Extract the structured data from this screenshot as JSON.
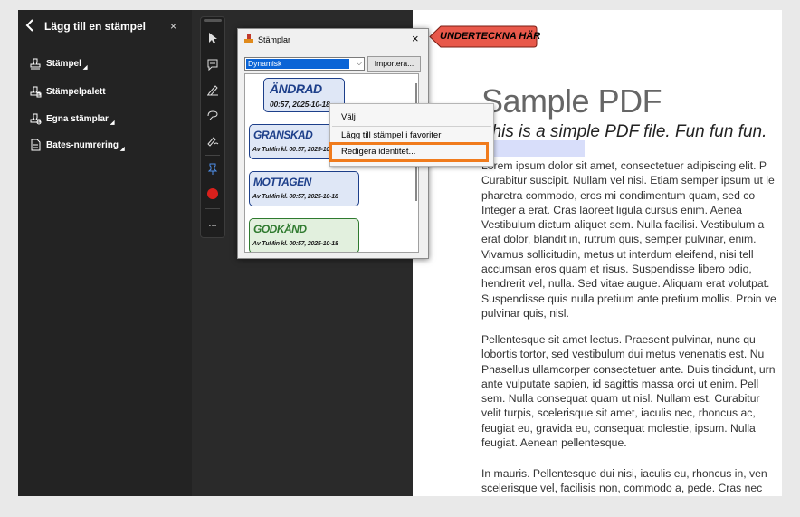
{
  "panel": {
    "title": "Lägg till en stämpel",
    "close_glyph": "×",
    "items": [
      {
        "label": "Stämpel",
        "icon": "stamp-icon"
      },
      {
        "label": "Stämpelpalett",
        "icon": "stamp-palette-icon"
      },
      {
        "label": "Egna stämplar",
        "icon": "custom-stamps-icon"
      },
      {
        "label": "Bates-numrering",
        "icon": "document-icon"
      }
    ]
  },
  "toolbar": {
    "tools": [
      "select-arrow-icon",
      "comment-icon",
      "pen-icon",
      "eraser-icon",
      "signature-icon",
      "pin-icon",
      "color-swatch-icon",
      "more-icon"
    ],
    "more_glyph": "...",
    "active_color": "#d9201c"
  },
  "dialog": {
    "title": "Stämplar",
    "close_glyph": "×",
    "category": "Dynamisk",
    "import_label": "Importera...",
    "stamps": [
      {
        "name": "ÄNDRAD",
        "detail": "00:57, 2025-10-18"
      },
      {
        "name": "GRANSKAD",
        "detail": "Av TuMin kl. 00:57, 2025-10-18"
      },
      {
        "name": "MOTTAGEN",
        "detail": "Av TuMin kl. 00:57, 2025-10-18"
      },
      {
        "name": "GODKÄND",
        "detail": "Av TuMin kl. 00:57, 2025-10-18"
      }
    ]
  },
  "context_menu": {
    "items": [
      "Välj",
      "Lägg till stämpel i favoriter",
      "Redigera identitet..."
    ]
  },
  "callout": {
    "text": "UNDERTECKNA HÄR"
  },
  "document": {
    "title": "Sample PDF",
    "subtitle": "This is a simple PDF file. Fun fun fun.",
    "paragraphs": [
      "Lorem ipsum dolor sit amet, consectetuer adipiscing elit. P\nCurabitur suscipit. Nullam vel nisi. Etiam semper ipsum ut le\npharetra commodo, eros mi condimentum quam, sed co\nInteger a erat. Cras laoreet ligula cursus enim. Aenea\nVestibulum dictum aliquet sem. Nulla facilisi. Vestibulum a\nerat dolor, blandit in, rutrum quis, semper pulvinar, enim.\nVivamus sollicitudin, metus ut interdum eleifend, nisi tell\naccumsan eros quam et risus. Suspendisse libero odio,\nhendrerit vel, nulla. Sed vitae augue. Aliquam erat volutpat.\nSuspendisse quis nulla pretium ante pretium mollis. Proin ve\npulvinar quis, nisl.",
      "Pellentesque sit amet lectus. Praesent pulvinar, nunc qu\nlobortis tortor, sed vestibulum dui metus venenatis est. Nu\nPhasellus ullamcorper consectetuer ante. Duis tincidunt, urn\nante vulputate sapien, id sagittis massa orci ut enim. Pell\nsem. Nulla consequat quam ut nisl. Nullam est. Curabitur\nvelit turpis, scelerisque sit amet, iaculis nec, rhoncus ac,\nfeugiat eu, gravida eu, consequat molestie, ipsum. Nulla\nfeugiat. Aenean pellentesque.",
      "In mauris. Pellentesque dui nisi, iaculis eu, rhoncus in, ven\nscelerisque vel, facilisis non, commodo a, pede. Cras nec"
    ]
  },
  "colors": {
    "panel_bg": "#232323",
    "stage_bg": "#2a2a2a",
    "highlight_orange": "#f07b1c",
    "callout_red": "#e8584a",
    "stamp_blue": "#1d3f8a",
    "stamp_green": "#2f7a2f"
  }
}
